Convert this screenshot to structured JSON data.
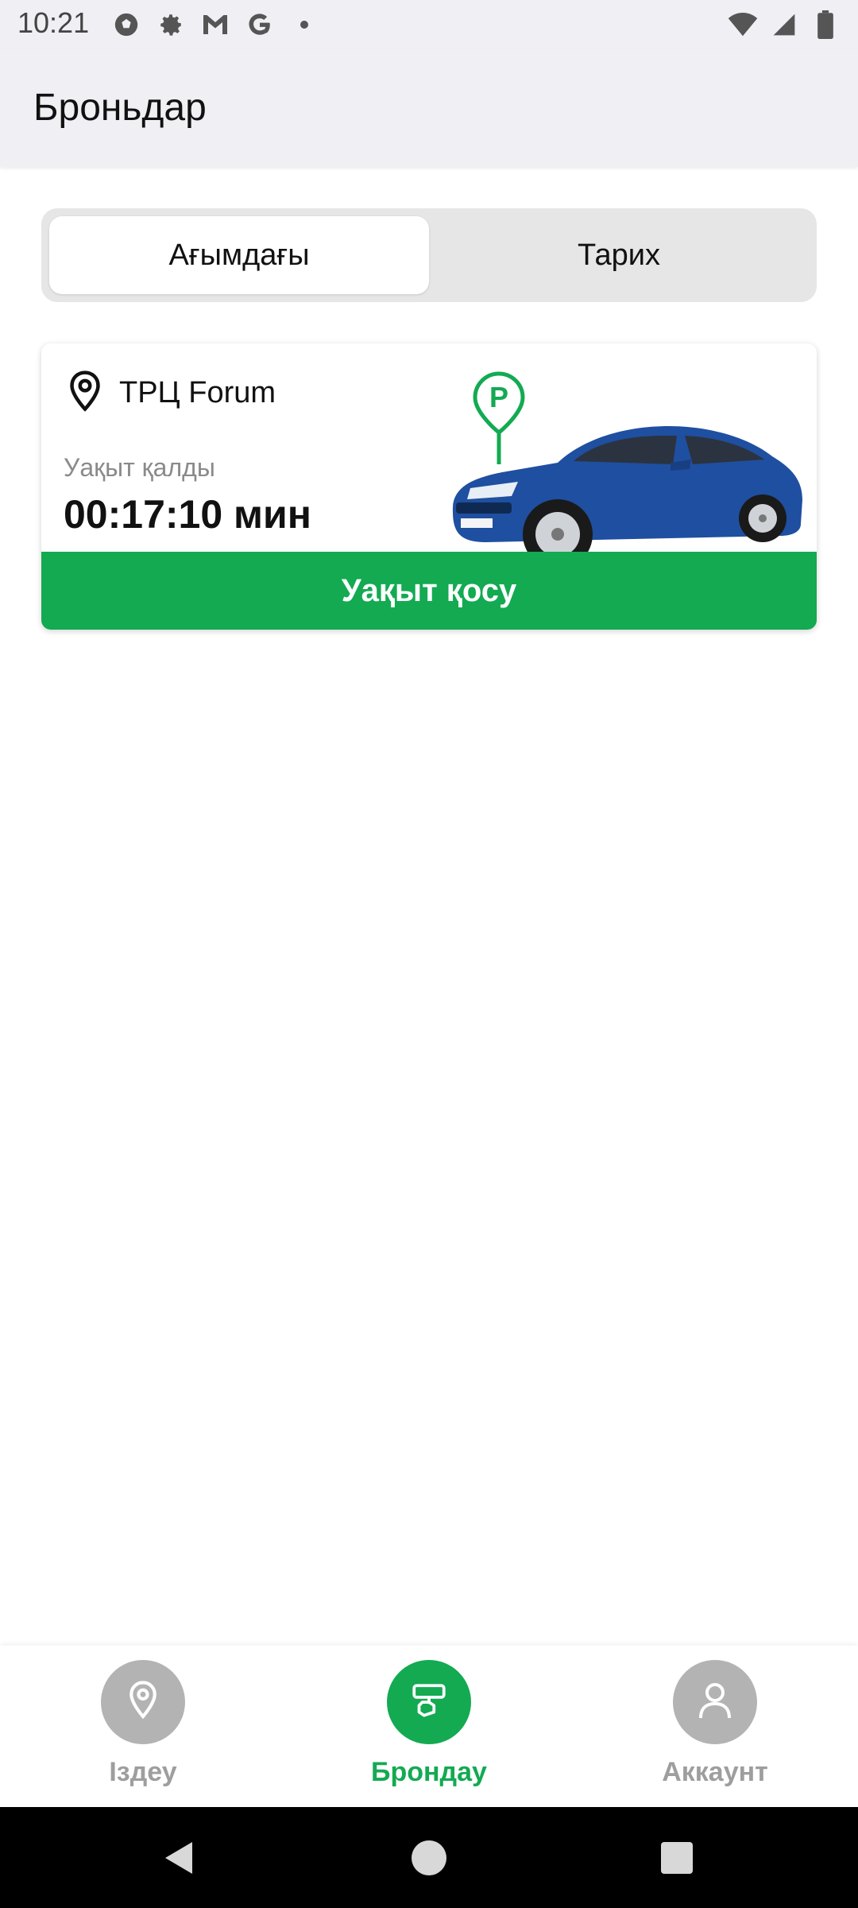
{
  "status_bar": {
    "time": "10:21",
    "left_icons": [
      "soccer-ball-icon",
      "gear-icon",
      "gmail-icon",
      "google-icon",
      "dot-icon"
    ],
    "right_icons": [
      "wifi-icon",
      "signal-icon",
      "battery-icon"
    ]
  },
  "app_bar": {
    "title": "Броньдар"
  },
  "tabs": {
    "items": [
      {
        "label": "Ағымдағы",
        "active": true
      },
      {
        "label": "Тарих",
        "active": false
      }
    ]
  },
  "booking": {
    "location": "ТРЦ Forum",
    "time_left_label": "Уақыт қалды",
    "time_left_value": "00:17:10 мин",
    "extend_button": "Уақыт қосу",
    "parking_marker": "P"
  },
  "bottom_nav": {
    "items": [
      {
        "label": "Іздеу",
        "icon": "location-pin-icon",
        "active": false
      },
      {
        "label": "Брондау",
        "icon": "booking-hand-icon",
        "active": true
      },
      {
        "label": "Аккаунт",
        "icon": "user-icon",
        "active": false
      }
    ]
  },
  "colors": {
    "accent": "#13aa52",
    "inactive_nav": "#b3b3b3",
    "appbar_bg": "#efeff4",
    "car_blue": "#1f4fa0"
  }
}
